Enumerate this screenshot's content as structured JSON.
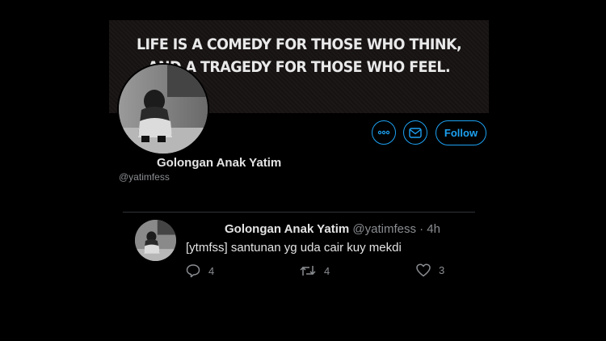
{
  "banner": {
    "quote_line1": "LIFE IS A COMEDY FOR THOSE WHO THINK,",
    "quote_line2": "AND A TRAGEDY FOR THOSE WHO FEEL."
  },
  "profile": {
    "name": "Golongan Anak Yatim",
    "handle": "@yatimfess",
    "avatar_icon": "person-sitting-photo"
  },
  "actions": {
    "more_icon": "more-icon",
    "message_icon": "mail-icon",
    "follow_label": "Follow"
  },
  "tweet": {
    "name": "Golongan Anak Yatim",
    "handle": "@yatimfess",
    "separator": "·",
    "time": "4h",
    "text": "[ytmfss] santunan yg uda cair kuy mekdi",
    "reply_count": "4",
    "retweet_count": "4",
    "like_count": "3"
  },
  "colors": {
    "background": "#000000",
    "accent": "#1da1f2",
    "muted_text": "#8a8d91",
    "primary_text": "#e4e4e4"
  }
}
